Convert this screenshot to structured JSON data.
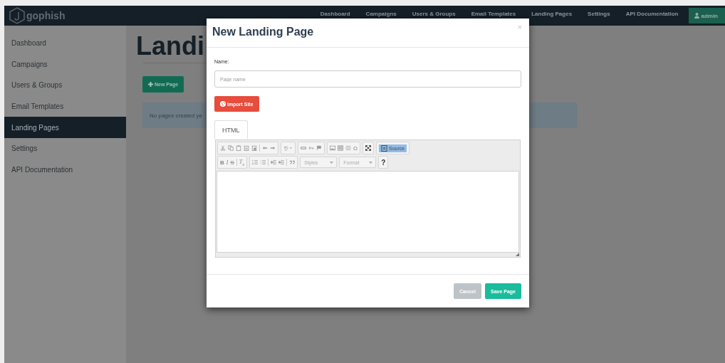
{
  "navbar": {
    "brand": "gophish",
    "links": [
      "Dashboard",
      "Campaigns",
      "Users & Groups",
      "Email Templates",
      "Landing Pages",
      "Settings",
      "API Documentation"
    ],
    "user_button": "admin"
  },
  "sidebar": {
    "items": [
      {
        "label": "Dashboard",
        "selected": false
      },
      {
        "label": "Campaigns",
        "selected": false
      },
      {
        "label": "Users & Groups",
        "selected": false
      },
      {
        "label": "Email Templates",
        "selected": false
      },
      {
        "label": "Landing Pages",
        "selected": true
      },
      {
        "label": "Settings",
        "selected": false
      },
      {
        "label": "API Documentation",
        "selected": false
      }
    ]
  },
  "main": {
    "heading": "Landi",
    "new_button": "New Page",
    "empty_message": "No pages created ye"
  },
  "modal": {
    "title": "New Landing Page",
    "close": "×",
    "name_label": "Name:",
    "name_field": {
      "placeholder": "Page name"
    },
    "import_button": "Import Site",
    "tabs": [
      {
        "label": "HTML",
        "selected": true
      }
    ],
    "toolbar": {
      "special_char": "Ω",
      "source": {
        "label": "Source",
        "selected": true
      },
      "bold": "B",
      "italic": "I",
      "strike": "S",
      "remove_format": "T$_{x}$",
      "styles": "Styles",
      "format": "Format",
      "help": "?"
    },
    "buttons": [
      {
        "label": "Cancel",
        "kind": "secondary"
      },
      {
        "label": "Save Page",
        "kind": "primary"
      }
    ]
  }
}
